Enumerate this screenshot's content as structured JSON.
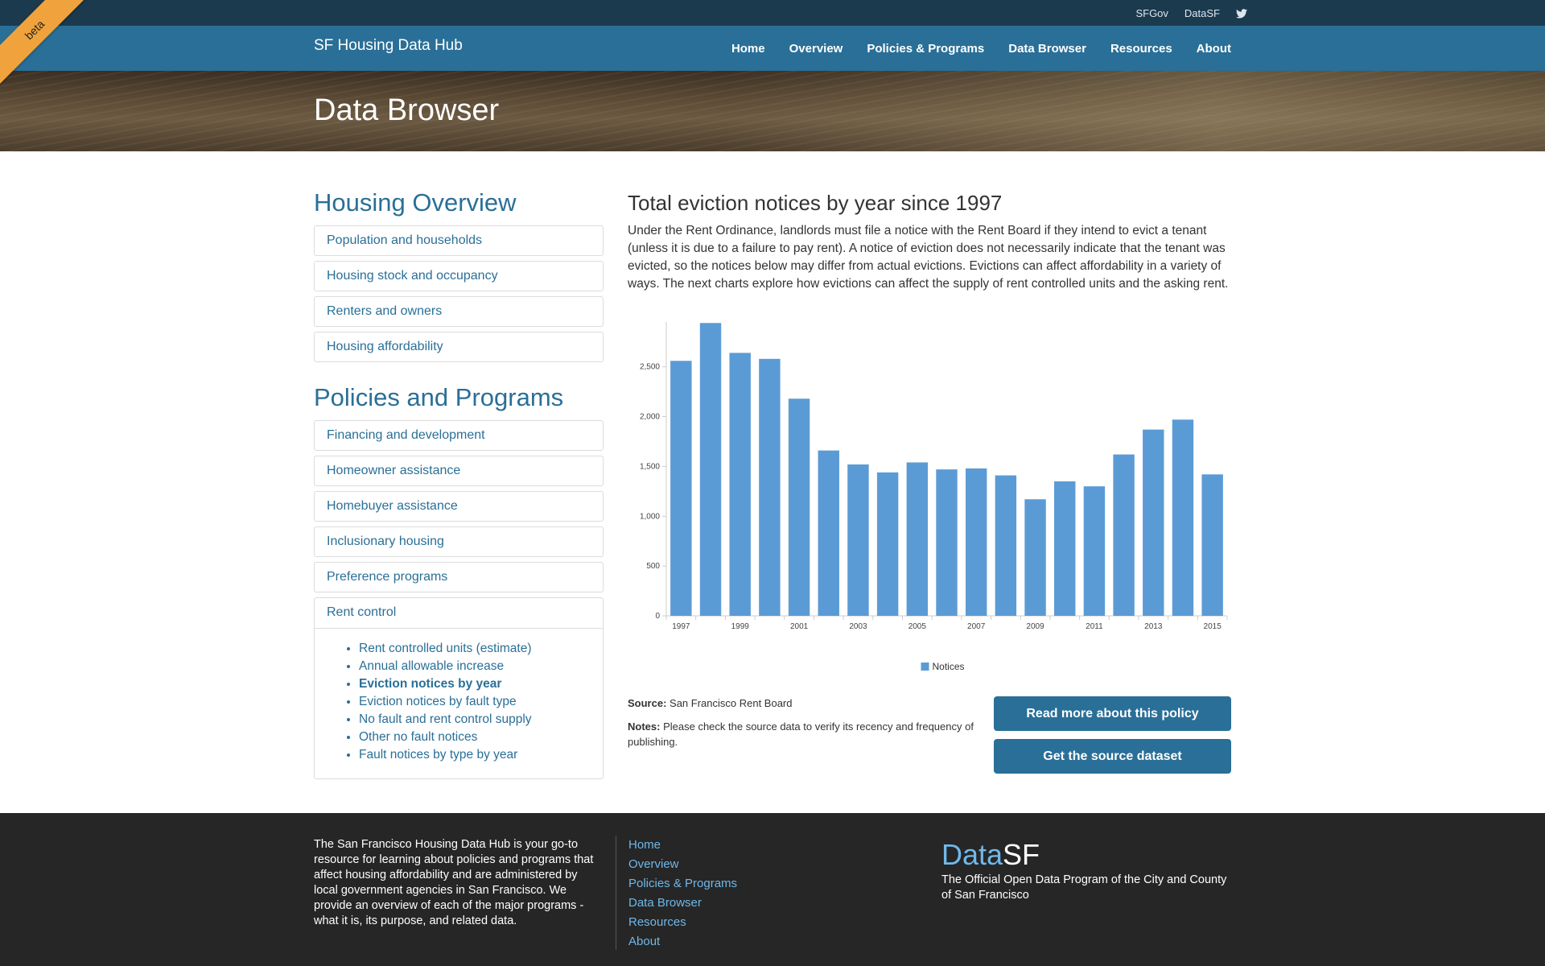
{
  "utility": {
    "links": [
      "SFGov",
      "DataSF"
    ],
    "twitter_icon": "twitter-icon"
  },
  "nav": {
    "brand": "SF Housing Data Hub",
    "links": [
      "Home",
      "Overview",
      "Policies & Programs",
      "Data Browser",
      "Resources",
      "About"
    ]
  },
  "ribbon": "beta",
  "hero": {
    "title": "Data Browser"
  },
  "sidebar": {
    "housing_heading": "Housing Overview",
    "housing_items": [
      "Population and households",
      "Housing stock and occupancy",
      "Renters and owners",
      "Housing affordability"
    ],
    "policies_heading": "Policies and Programs",
    "policies_items": [
      "Financing and development",
      "Homeowner assistance",
      "Homebuyer assistance",
      "Inclusionary housing",
      "Preference programs"
    ],
    "rent_control": {
      "label": "Rent control",
      "sub_items": [
        "Rent controlled units (estimate)",
        "Annual allowable increase",
        "Eviction notices by year",
        "Eviction notices by fault type",
        "No fault and rent control supply",
        "Other no fault notices",
        "Fault notices by type by year"
      ],
      "active": "Eviction notices by year"
    }
  },
  "content": {
    "title": "Total eviction notices by year since 1997",
    "description": "Under the Rent Ordinance, landlords must file a notice with the Rent Board if they intend to evict a tenant (unless it is due to a failure to pay rent). A notice of eviction does not necessarily indicate that the tenant was evicted, so the notices below may differ from actual evictions. Evictions can affect affordability in a variety of ways. The next charts explore how evictions can affect the supply of rent controlled units and the asking rent.",
    "source_label": "Source:",
    "source_value": "San Francisco Rent Board",
    "notes_label": "Notes:",
    "notes_value": "Please check the source data to verify its recency and frequency of publishing.",
    "button_policy": "Read more about this policy",
    "button_dataset": "Get the source dataset"
  },
  "chart_data": {
    "type": "bar",
    "categories": [
      "1997",
      "1998",
      "1999",
      "2000",
      "2001",
      "2002",
      "2003",
      "2004",
      "2005",
      "2006",
      "2007",
      "2008",
      "2009",
      "2010",
      "2011",
      "2012",
      "2013",
      "2014",
      "2015"
    ],
    "x_tick_labels": [
      "1997",
      "1999",
      "2001",
      "2003",
      "2005",
      "2007",
      "2009",
      "2011",
      "2013",
      "2015"
    ],
    "series": [
      {
        "name": "Notices",
        "values": [
          2560,
          2940,
          2640,
          2580,
          2180,
          1660,
          1520,
          1440,
          1540,
          1470,
          1480,
          1410,
          1170,
          1350,
          1300,
          1620,
          1870,
          1970,
          1420
        ]
      }
    ],
    "ylim": [
      0,
      2950
    ],
    "y_ticks": [
      0,
      500,
      1000,
      1500,
      2000,
      2500
    ],
    "y_tick_labels": [
      "0",
      "500",
      "1,000",
      "1,500",
      "2,000",
      "2,500"
    ],
    "legend_position": "bottom-center",
    "bar_color": "#5b9bd5",
    "title": "",
    "xlabel": "",
    "ylabel": ""
  },
  "footer": {
    "about": "The San Francisco Housing Data Hub is your go-to resource for learning about policies and programs that affect housing affordability and are administered by local government agencies in San Francisco. We provide an overview of each of the major programs - what it is, its purpose, and related data.",
    "links": [
      "Home",
      "Overview",
      "Policies & Programs",
      "Data Browser",
      "Resources",
      "About"
    ],
    "logo_data": "Data",
    "logo_sf": "SF",
    "tagline": "The Official Open Data Program of the City and County of San Francisco"
  },
  "colors": {
    "nav": "#2a6f97",
    "utility": "#1c3a4e",
    "ribbon": "#f0a33c",
    "footer": "#262626",
    "link": "#2a6f97"
  }
}
